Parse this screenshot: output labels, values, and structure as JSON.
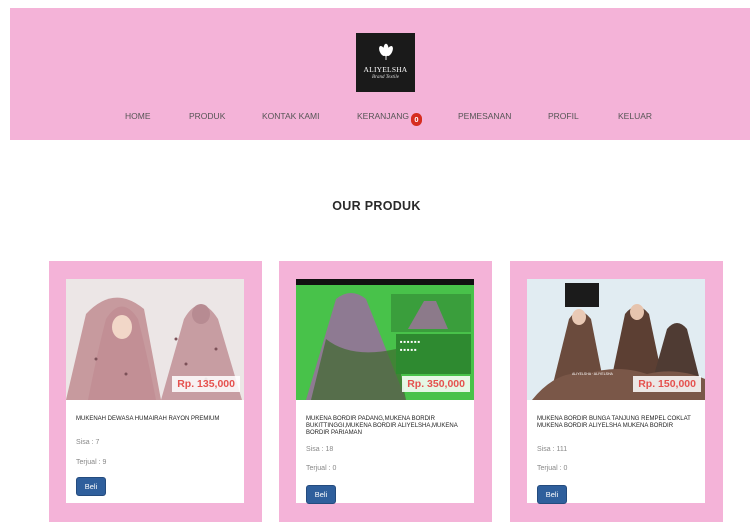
{
  "brand": {
    "name": "ALIYELSHA",
    "tagline": "Brand Textile",
    "icon": "lotus-flower-logo"
  },
  "nav": {
    "items": [
      {
        "id": "home",
        "label": "HOME"
      },
      {
        "id": "produk",
        "label": "PRODUK"
      },
      {
        "id": "kontak",
        "label": "KONTAK KAMI"
      },
      {
        "id": "keranjang",
        "label": "KERANJANG",
        "badge": "0"
      },
      {
        "id": "pemesanan",
        "label": "PEMESANAN"
      },
      {
        "id": "profil",
        "label": "PROFIL"
      },
      {
        "id": "keluar",
        "label": "KELUAR"
      }
    ]
  },
  "section": {
    "title": "OUR PRODUK"
  },
  "colors": {
    "header_bg": "#f4b3d8",
    "price": "#e5514e",
    "button": "#2f5f9c",
    "badge": "#d62d20"
  },
  "products": [
    {
      "price": "Rp. 135,000",
      "name": "MUKENAH DEWASA HUMAIRAH RAYON PREMIUM",
      "stock": "Sisa : 7",
      "sold": "Terjual : 9",
      "button": "Beli"
    },
    {
      "price": "Rp. 350,000",
      "name": "MUKENA BORDIR PADANG,MUKENA BORDIR BUKITTINGGI,MUKENA BORDIR ALIYELSHA,MUKENA BORDIR PARIAMAN",
      "stock": "Sisa : 18",
      "sold": "Terjual : 0",
      "button": "Beli"
    },
    {
      "price": "Rp. 150,000",
      "name": "MUKENA BORDIR BUNGA TANJUNG REMPEL COKLAT MUKENA BORDIR ALIYELSHA MUKENA BORDIR",
      "stock": "Sisa : 111",
      "sold": "Terjual : 0",
      "button": "Beli"
    }
  ]
}
